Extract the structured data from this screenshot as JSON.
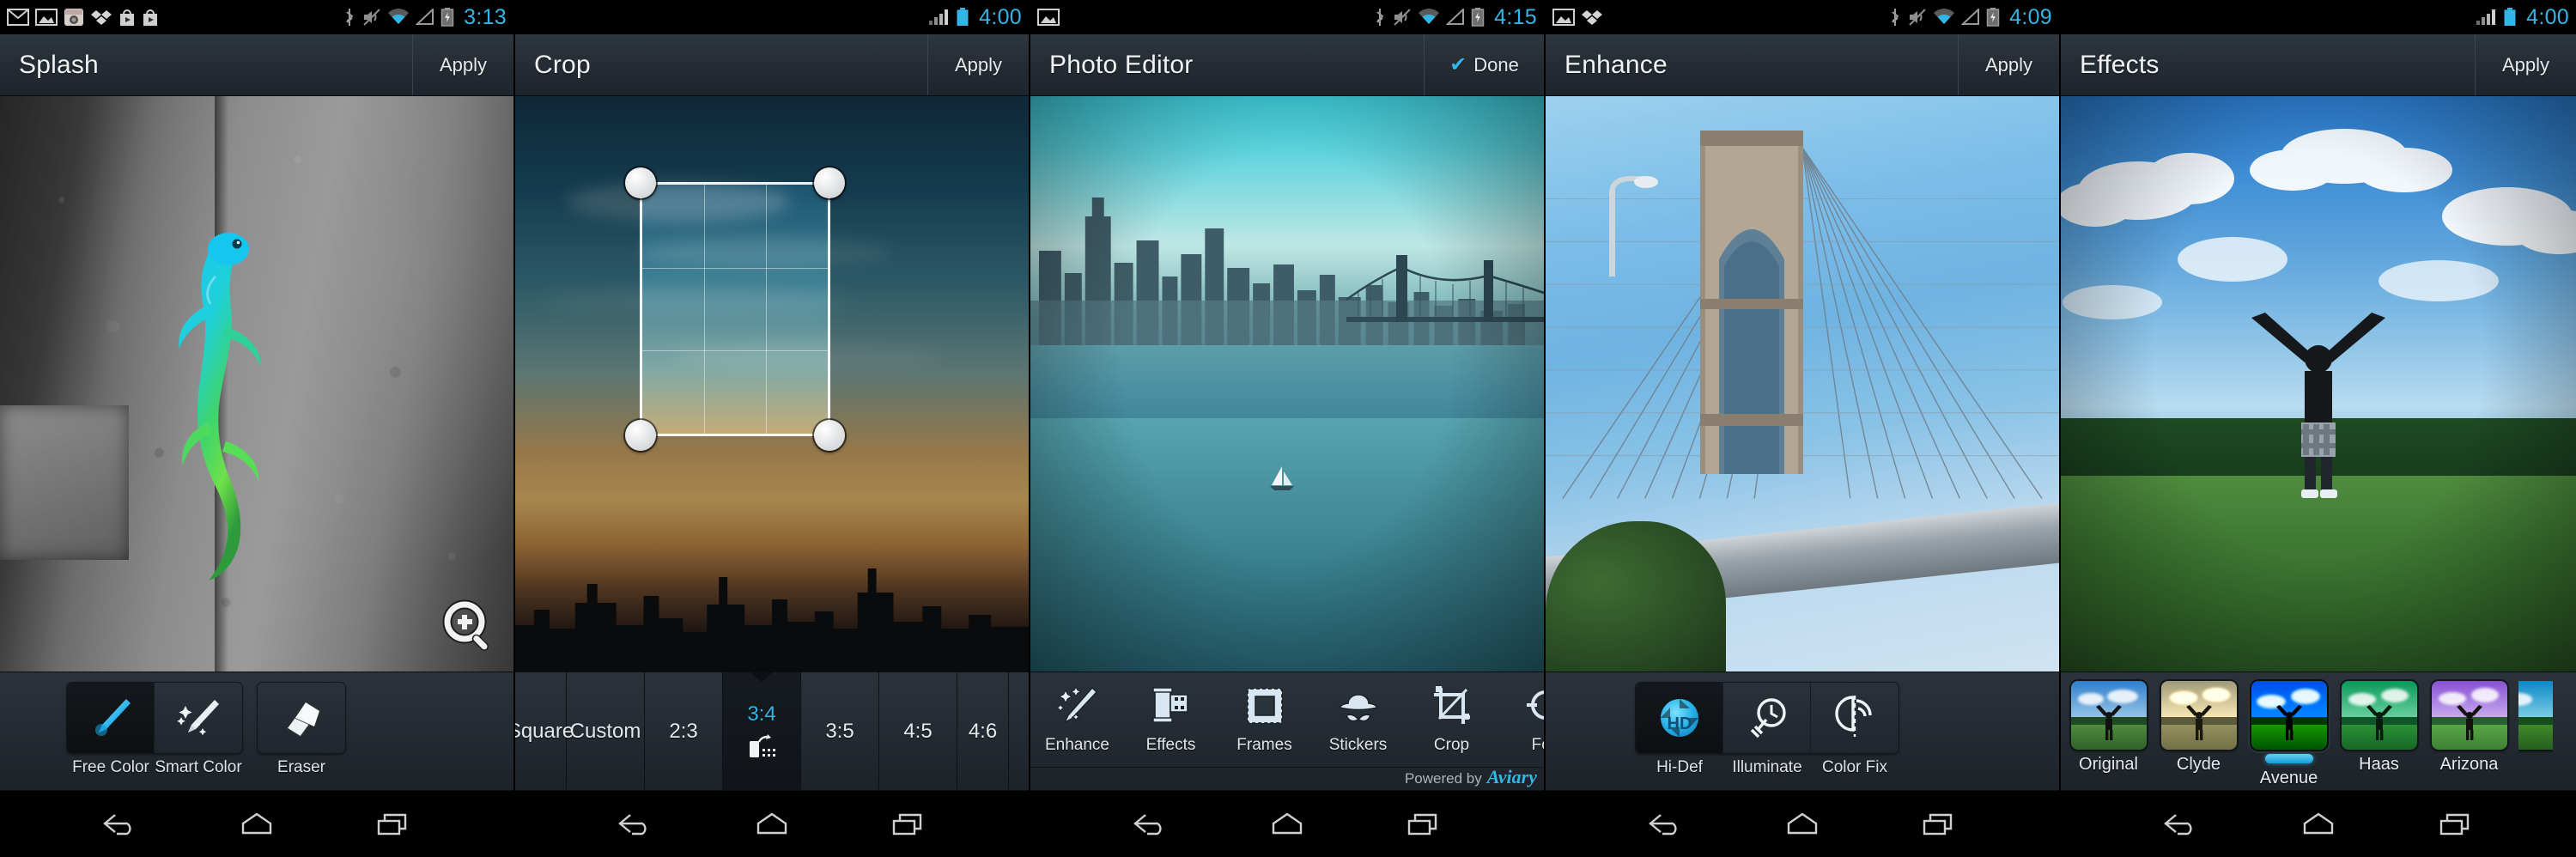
{
  "panels": [
    {
      "id": "splash",
      "statusbar": {
        "time": "3:13",
        "left_icons": [
          "gmail-icon",
          "gallery-icon",
          "instagram-icon",
          "dropbox-icon",
          "play-store-icon",
          "play-store-icon"
        ],
        "right_icons": [
          "bluetooth-icon",
          "mute-icon",
          "wifi-icon",
          "signal-icon",
          "battery-charging-icon"
        ]
      },
      "title": "Splash",
      "action": {
        "label": "Apply",
        "icon": ""
      },
      "canvas": {
        "overlay_icon": "zoom-in-icon",
        "subject": "lizard-on-rock"
      },
      "tools": [
        {
          "label": "Free Color",
          "icon": "paint-brush-icon",
          "selected": true
        },
        {
          "label": "Smart Color",
          "icon": "magic-brush-icon",
          "selected": false
        },
        {
          "label": "Eraser",
          "icon": "eraser-icon",
          "selected": false
        }
      ]
    },
    {
      "id": "crop",
      "statusbar": {
        "time": "4:00",
        "left_icons": [],
        "right_icons": [
          "signal-icon",
          "battery-icon"
        ]
      },
      "title": "Crop",
      "action": {
        "label": "Apply",
        "icon": ""
      },
      "canvas": {
        "subject": "city-sunset-skyline",
        "crop_grid": true,
        "handles": 4
      },
      "ratios": [
        {
          "label": "Square",
          "selected": false,
          "partial": true
        },
        {
          "label": "Custom",
          "selected": false
        },
        {
          "label": "2:3",
          "selected": false
        },
        {
          "label": "3:4",
          "selected": true,
          "icon": "rotate-orientation-icon"
        },
        {
          "label": "3:5",
          "selected": false
        },
        {
          "label": "4:5",
          "selected": false
        },
        {
          "label": "4:6",
          "selected": false,
          "partial": true
        }
      ]
    },
    {
      "id": "photo-editor",
      "statusbar": {
        "time": "4:15",
        "left_icons": [
          "gallery-icon"
        ],
        "right_icons": [
          "bluetooth-icon",
          "mute-icon",
          "wifi-icon",
          "signal-icon",
          "battery-charging-icon"
        ]
      },
      "title": "Photo Editor",
      "action": {
        "label": "Done",
        "icon": "check-icon"
      },
      "canvas": {
        "subject": "manhattan-skyline-brooklyn-bridge"
      },
      "edit_tools": [
        {
          "label": "Enhance",
          "icon": "magic-wand-icon"
        },
        {
          "label": "Effects",
          "icon": "film-roll-icon"
        },
        {
          "label": "Frames",
          "icon": "picture-frame-icon"
        },
        {
          "label": "Stickers",
          "icon": "hat-mustache-icon"
        },
        {
          "label": "Crop",
          "icon": "crop-icon"
        },
        {
          "label": "Foc",
          "icon": "focus-icon",
          "partial": true
        }
      ],
      "footer": {
        "text": "Powered by",
        "brand": "Aviary"
      }
    },
    {
      "id": "enhance",
      "statusbar": {
        "time": "4:09",
        "left_icons": [
          "gallery-icon",
          "dropbox-icon"
        ],
        "right_icons": [
          "bluetooth-icon",
          "mute-icon",
          "wifi-icon",
          "signal-icon",
          "battery-charging-icon"
        ]
      },
      "title": "Enhance",
      "action": {
        "label": "Apply",
        "icon": ""
      },
      "canvas": {
        "subject": "brooklyn-bridge-tower"
      },
      "tools": [
        {
          "label": "Hi-Def",
          "icon": "hd-aperture-icon",
          "selected": true
        },
        {
          "label": "Illuminate",
          "icon": "light-bulb-icon",
          "selected": false
        },
        {
          "label": "Color Fix",
          "icon": "color-fix-icon",
          "selected": false
        }
      ]
    },
    {
      "id": "effects",
      "statusbar": {
        "time": "4:00",
        "left_icons": [],
        "right_icons": [
          "signal-icon",
          "battery-icon"
        ]
      },
      "title": "Effects",
      "action": {
        "label": "Apply",
        "icon": ""
      },
      "canvas": {
        "subject": "man-arms-raised-in-field"
      },
      "filters": [
        {
          "label": "Original",
          "selected": false,
          "sky": "#4a8fd6",
          "tint": "none"
        },
        {
          "label": "Clyde",
          "selected": false,
          "sky": "#8a9a78",
          "tint": "sepia"
        },
        {
          "label": "Avenue",
          "selected": true,
          "sky": "#1f6fc4",
          "tint": "vivid-blue"
        },
        {
          "label": "Haas",
          "selected": false,
          "sky": "#2f9c86",
          "tint": "teal"
        },
        {
          "label": "Arizona",
          "selected": false,
          "sky": "#6e6fd0",
          "tint": "violet"
        }
      ]
    }
  ],
  "navbar": {
    "items": [
      {
        "name": "back-button",
        "icon": "back-arrow-icon"
      },
      {
        "name": "home-button",
        "icon": "home-icon"
      },
      {
        "name": "recents-button",
        "icon": "recents-icon"
      }
    ]
  },
  "colors": {
    "accent": "#33b5e5",
    "bar_top": "#2e363e",
    "bar_bottom": "#1d242b",
    "text": "#f0f2f4",
    "black": "#000000"
  }
}
